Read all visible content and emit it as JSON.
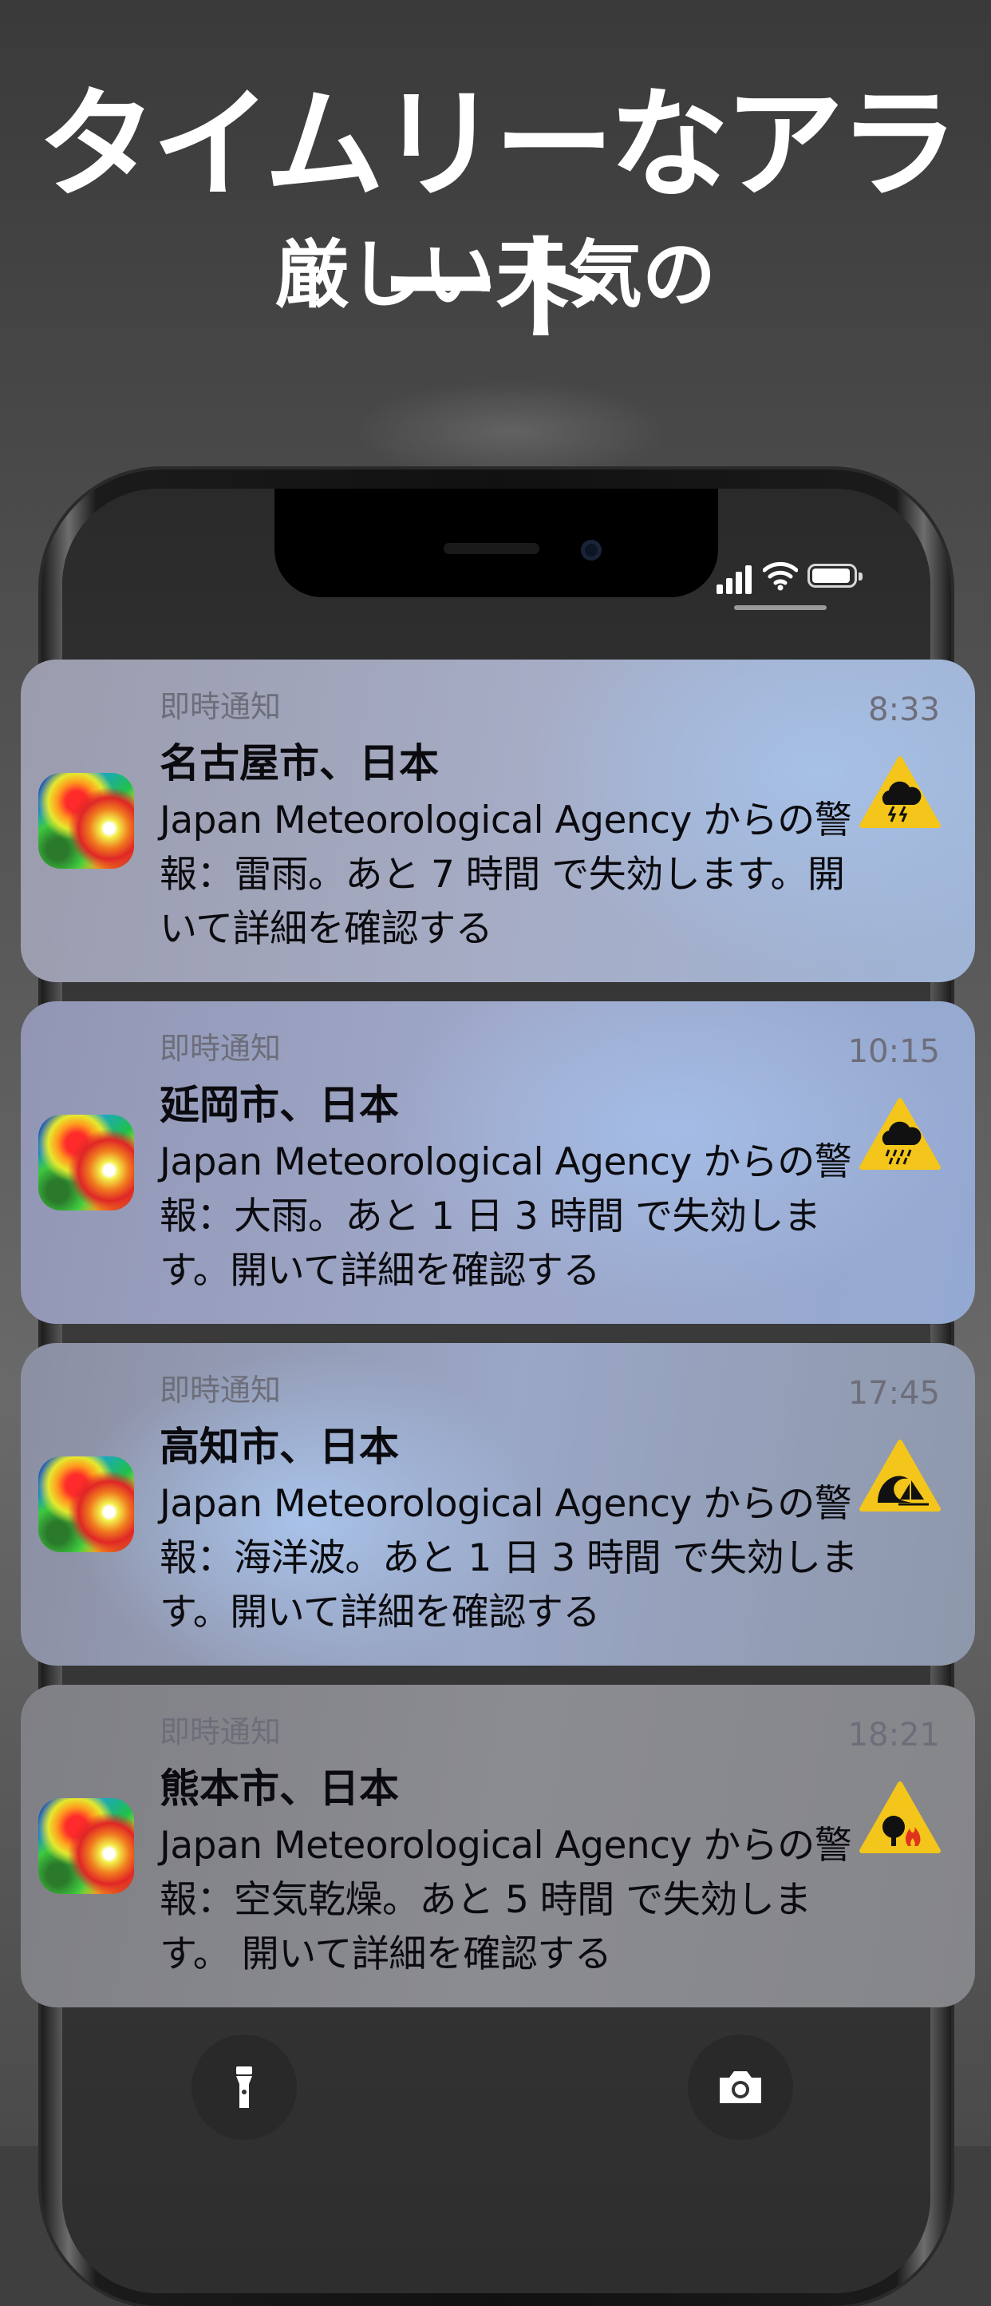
{
  "promo": {
    "headline": "タイムリーなアラート",
    "subhead": "厳しい天気の"
  },
  "status_bar": {
    "signal": "signal-icon",
    "wifi": "wifi-icon",
    "battery": "battery-icon"
  },
  "notifications": [
    {
      "category": "即時通知",
      "time": "8:33",
      "title": "名古屋市、日本",
      "body": "Japan Meteorological Agency からの警報：雷雨。あと 7  時間 で失効します。開いて詳細を確認する",
      "alert_icon": "thunderstorm-warning-icon"
    },
    {
      "category": "即時通知",
      "time": "10:15",
      "title": "延岡市、日本",
      "body": "Japan Meteorological Agency からの警報：大雨。あと 1 日 3 時間 で失効します。開いて詳細を確認する",
      "alert_icon": "heavy-rain-warning-icon"
    },
    {
      "category": "即時通知",
      "time": "17:45",
      "title": "高知市、日本",
      "body": "Japan Meteorological Agency からの警報：海洋波。あと 1 日 3 時間 で失効します。開いて詳細を確認する",
      "alert_icon": "high-waves-warning-icon"
    },
    {
      "category": "即時通知",
      "time": "18:21",
      "title": "熊本市、日本",
      "body": "Japan Meteorological Agency からの警報：空気乾燥。あと 5 時間 で失効します。 開いて詳細を確認する",
      "alert_icon": "dry-air-fire-warning-icon"
    }
  ],
  "lockscreen": {
    "flashlight": "flashlight-icon",
    "camera": "camera-icon"
  },
  "colors": {
    "warning_yellow": "#f4c51a",
    "text_dark": "#0b0b0f",
    "text_muted": "#6d6e7a"
  }
}
